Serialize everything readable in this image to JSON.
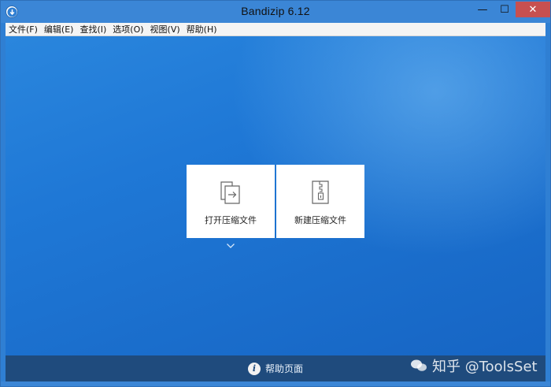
{
  "window": {
    "title": "Bandizip 6.12",
    "controls": {
      "minimize": "—",
      "maximize": "☐",
      "close": "✕"
    }
  },
  "menu": [
    {
      "label": "文件(F)"
    },
    {
      "label": "编辑(E)"
    },
    {
      "label": "查找(I)"
    },
    {
      "label": "选项(O)"
    },
    {
      "label": "视图(V)"
    },
    {
      "label": "帮助(H)"
    }
  ],
  "tiles": {
    "open": {
      "label": "打开压缩文件",
      "icon": "open-archive-icon"
    },
    "new": {
      "label": "新建压缩文件",
      "icon": "new-archive-icon"
    }
  },
  "footer": {
    "help_label": "帮助页面",
    "icon": "info-icon"
  },
  "watermark": {
    "text": "知乎 @ToolsSet"
  },
  "colors": {
    "titlebar": "#3b86d6",
    "close_button": "#c75050",
    "content_bg": "#1f78d6",
    "footer_bg": "#1f4b7d",
    "tile_bg": "#ffffff"
  }
}
